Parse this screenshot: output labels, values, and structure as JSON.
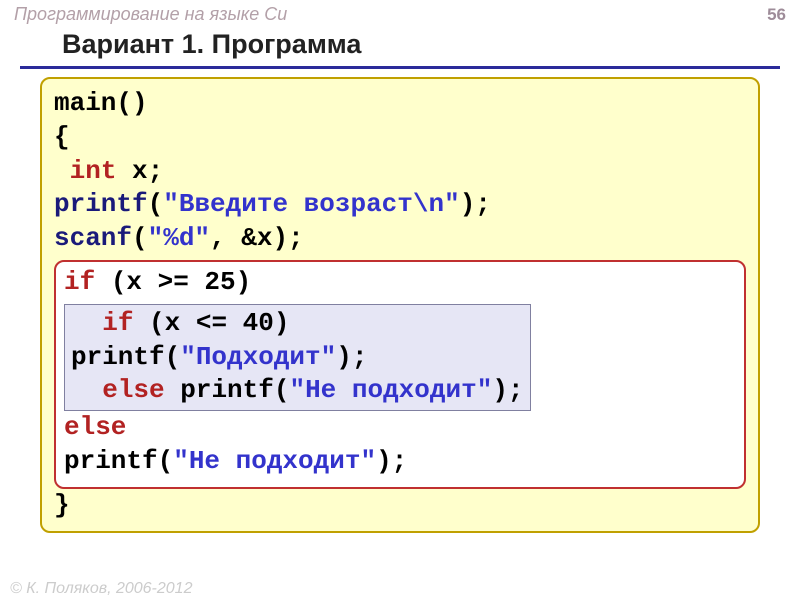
{
  "header": {
    "course_title": "Программирование на языке Си",
    "page_number": "56"
  },
  "slide": {
    "title": "Вариант 1. Программа"
  },
  "code": {
    "main_sig": "main()",
    "open_brace": "{",
    "kw_int": "int",
    "var_decl_rest": " x;",
    "printf1_fn": " printf",
    "printf1_open": "(",
    "printf1_str": "\"Введите возраст\\n\"",
    "printf1_close": ");",
    "scanf_fn": " scanf",
    "scanf_open": "(",
    "scanf_str": "\"%d\"",
    "scanf_rest": ", &x);",
    "if1_kw": "if",
    "if1_cond": " (x >= 25)",
    "if2_kw": "if",
    "if2_cond": " (x <= 40)",
    "printf2_lead": "      printf(",
    "printf2_str": "\"Подходит\"",
    "printf2_close": ");",
    "else1_kw": "else",
    "else1_printf": " printf(",
    "else1_str": "\"Не подходит\"",
    "else1_close": ");",
    "else2_kw": "else",
    "printf3_lead": "   printf(",
    "printf3_str": "\"Не подходит\"",
    "printf3_close": ");",
    "close_brace": "}"
  },
  "footer": {
    "copyright": "© К. Поляков, 2006-2012"
  }
}
